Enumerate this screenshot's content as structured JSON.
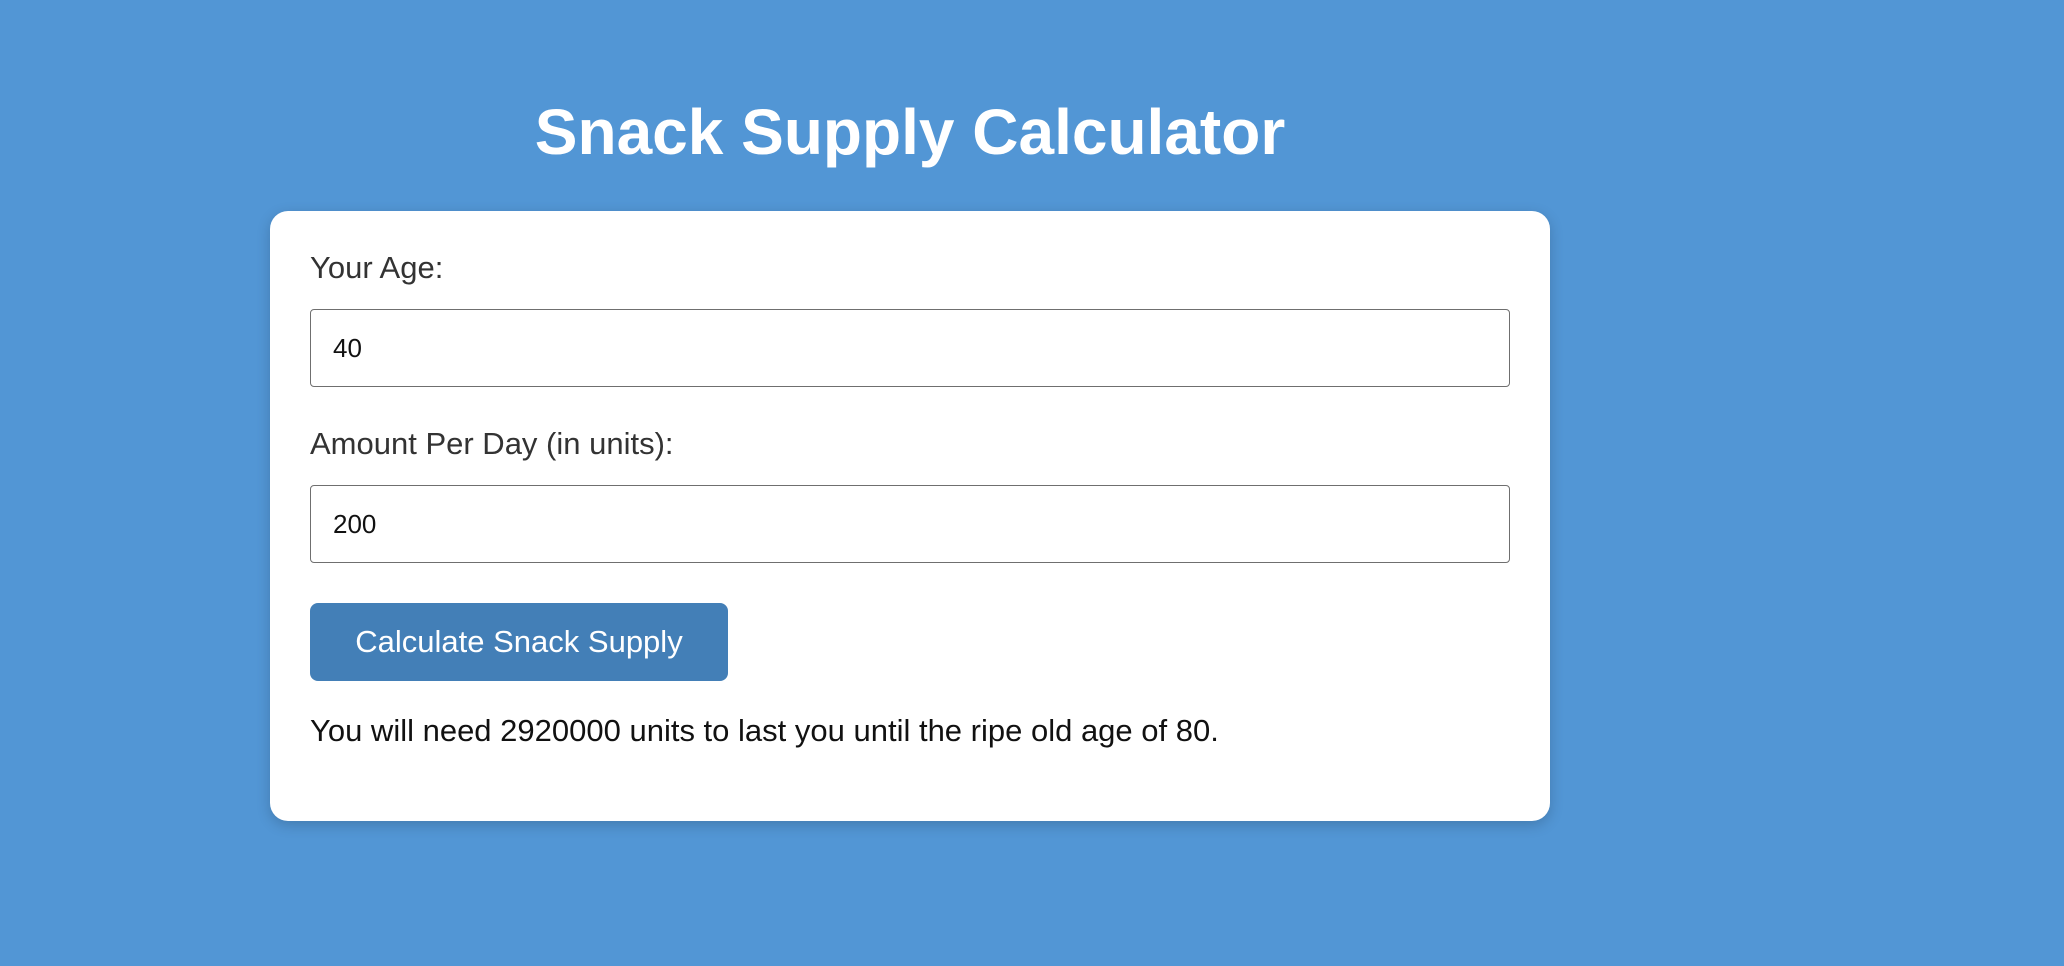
{
  "header": {
    "title": "Snack Supply Calculator"
  },
  "form": {
    "age_label": "Your Age:",
    "age_value": "40",
    "amount_label": "Amount Per Day (in units):",
    "amount_value": "200",
    "submit_label": "Calculate Snack Supply"
  },
  "result": {
    "text": "You will need 2920000 units to last you until the ripe old age of 80."
  },
  "colors": {
    "background": "#5296d5",
    "button": "#437fb7",
    "card": "#ffffff"
  }
}
